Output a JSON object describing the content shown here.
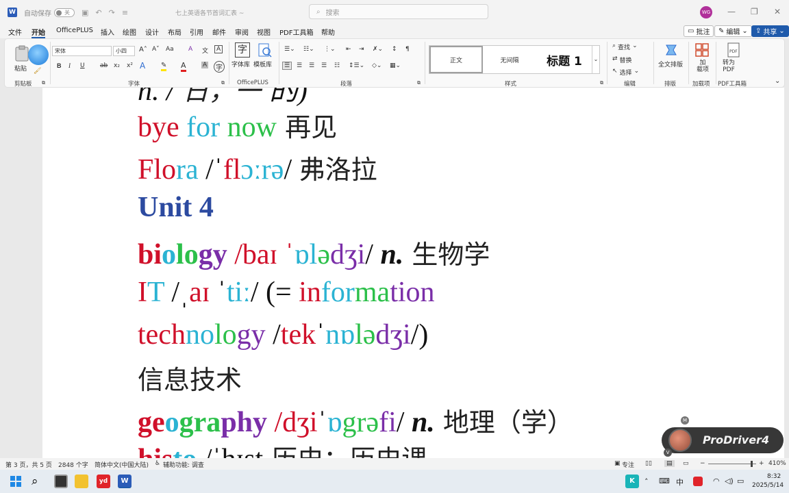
{
  "titlebar": {
    "app_icon": "W",
    "autosave_label": "自动保存",
    "autosave_state": "关",
    "doc_title": "七上英语各节首词汇表 ~",
    "search_placeholder": "搜索",
    "user_initials": "WG",
    "icons": [
      "save-icon",
      "undo-icon",
      "redo-icon",
      "customize-icon"
    ]
  },
  "menu": {
    "tabs": [
      "文件",
      "开始",
      "OfficePLUS",
      "插入",
      "绘图",
      "设计",
      "布局",
      "引用",
      "邮件",
      "审阅",
      "视图",
      "PDF工具箱",
      "帮助"
    ],
    "active_index": 1,
    "comment_label": "批注",
    "edit_label": "编辑",
    "share_label": "共享"
  },
  "ribbon": {
    "paste_label": "粘贴",
    "clipboard_label": "剪贴板",
    "font_name": "宋体",
    "font_size": "小四",
    "font_group_label": "字体",
    "officeplus_font_label": "字体库",
    "officeplus_template_label": "模板库",
    "officeplus_group_label": "OfficePLUS",
    "paragraph_label": "段落",
    "styles": [
      "正文",
      "无间隔",
      "标题 1"
    ],
    "styles_label": "样式",
    "find_label": "查找",
    "replace_label": "替换",
    "select_label": "选择",
    "edit_group_label": "编辑",
    "layout_label": "全文排版",
    "layout_group_label": "排版",
    "addin_label": "加载项",
    "addin_button": "加\n载项",
    "pdf_label": "转为\nPDF",
    "pdf_group_label": "PDF工具箱",
    "text_buttons": {
      "bold": "B",
      "italic": "I",
      "underline": "U",
      "strikethrough": "ab",
      "subscript": "x₂",
      "superscript": "x²",
      "text_effect": "A",
      "highlight": "✎",
      "font_color": "A",
      "char_shading": "A",
      "char_border": "A",
      "grow_font": "A˄",
      "shrink_font": "A˅",
      "change_case": "Aa",
      "clear_format": "A",
      "phonetic": "文",
      "encircle": "字"
    }
  },
  "document": {
    "lines": [
      {
        "segments": [
          [
            "bye ",
            "r"
          ],
          [
            "for ",
            "c"
          ],
          [
            "now",
            "g"
          ],
          [
            "  再见",
            "cn"
          ]
        ]
      },
      {
        "segments": [
          [
            "Flo",
            "r"
          ],
          [
            "ra",
            "c"
          ],
          [
            " /ˈ",
            "k"
          ],
          [
            "fl",
            "r"
          ],
          [
            "ɔː",
            "c"
          ],
          [
            "rə",
            "c"
          ],
          [
            "/  ",
            "k"
          ],
          [
            "弗洛拉",
            "cn"
          ]
        ]
      },
      {
        "segments": [
          [
            "Unit 4",
            "b"
          ]
        ]
      },
      {
        "segments": [
          [
            "bi",
            "r"
          ],
          [
            "o",
            "c"
          ],
          [
            "lo",
            "g"
          ],
          [
            "gy",
            "p"
          ],
          [
            " /ba",
            "r"
          ],
          [
            "ɪ ˈ",
            "r"
          ],
          [
            "ɒl",
            "c"
          ],
          [
            "ə",
            "g"
          ],
          [
            "dʒi",
            "p"
          ],
          [
            "/ ",
            "k"
          ],
          [
            "n.",
            "i"
          ],
          [
            "  生物学",
            "cn"
          ]
        ]
      },
      {
        "segments": [
          [
            "I",
            "r"
          ],
          [
            "T",
            "c"
          ],
          [
            " /ˌ",
            "k"
          ],
          [
            "aɪ ",
            "r"
          ],
          [
            "ˈ",
            "k"
          ],
          [
            "tiː",
            "c"
          ],
          [
            "/ (= ",
            "k"
          ],
          [
            "in",
            "r"
          ],
          [
            "for",
            "c"
          ],
          [
            "ma",
            "g"
          ],
          [
            "tion",
            "p"
          ]
        ]
      },
      {
        "segments": [
          [
            "tech",
            "r"
          ],
          [
            "no",
            "c"
          ],
          [
            "lo",
            "g"
          ],
          [
            "gy",
            "p"
          ],
          [
            " /",
            "k"
          ],
          [
            "tek",
            "r"
          ],
          [
            "ˈ",
            "k"
          ],
          [
            "nɒ",
            "c"
          ],
          [
            "lə",
            "g"
          ],
          [
            "dʒi",
            "p"
          ],
          [
            "/)",
            "k"
          ]
        ]
      },
      {
        "segments": [
          [
            "信息技术",
            "cn"
          ]
        ]
      },
      {
        "segments": [
          [
            "ge",
            "r"
          ],
          [
            "o",
            "c"
          ],
          [
            "gra",
            "g"
          ],
          [
            "phy",
            "p"
          ],
          [
            " /dʒi",
            "r"
          ],
          [
            "ˈ",
            "k"
          ],
          [
            "ɒ",
            "c"
          ],
          [
            "grə",
            "g"
          ],
          [
            "fi",
            "p"
          ],
          [
            "/ ",
            "k"
          ],
          [
            "n.",
            "i"
          ],
          [
            "  地理（学）",
            "cn"
          ]
        ]
      }
    ]
  },
  "overlay": {
    "brand": "ProDriver4",
    "m_badge": "M",
    "v_badge": "V"
  },
  "statusbar": {
    "page_info": "第 3 页，共 5 页",
    "word_count": "2848 个字",
    "language": "简体中文(中国大陆)",
    "accessibility": "辅助功能: 调查",
    "focus_label": "专注",
    "zoom_level": "410%"
  },
  "taskbar": {
    "time": "8:32",
    "date": "2025/5/14",
    "ime": "中",
    "apps": [
      "start-icon",
      "search-icon",
      "task-view-icon",
      "file-explorer-icon",
      "youdao-icon",
      "word-icon"
    ]
  }
}
